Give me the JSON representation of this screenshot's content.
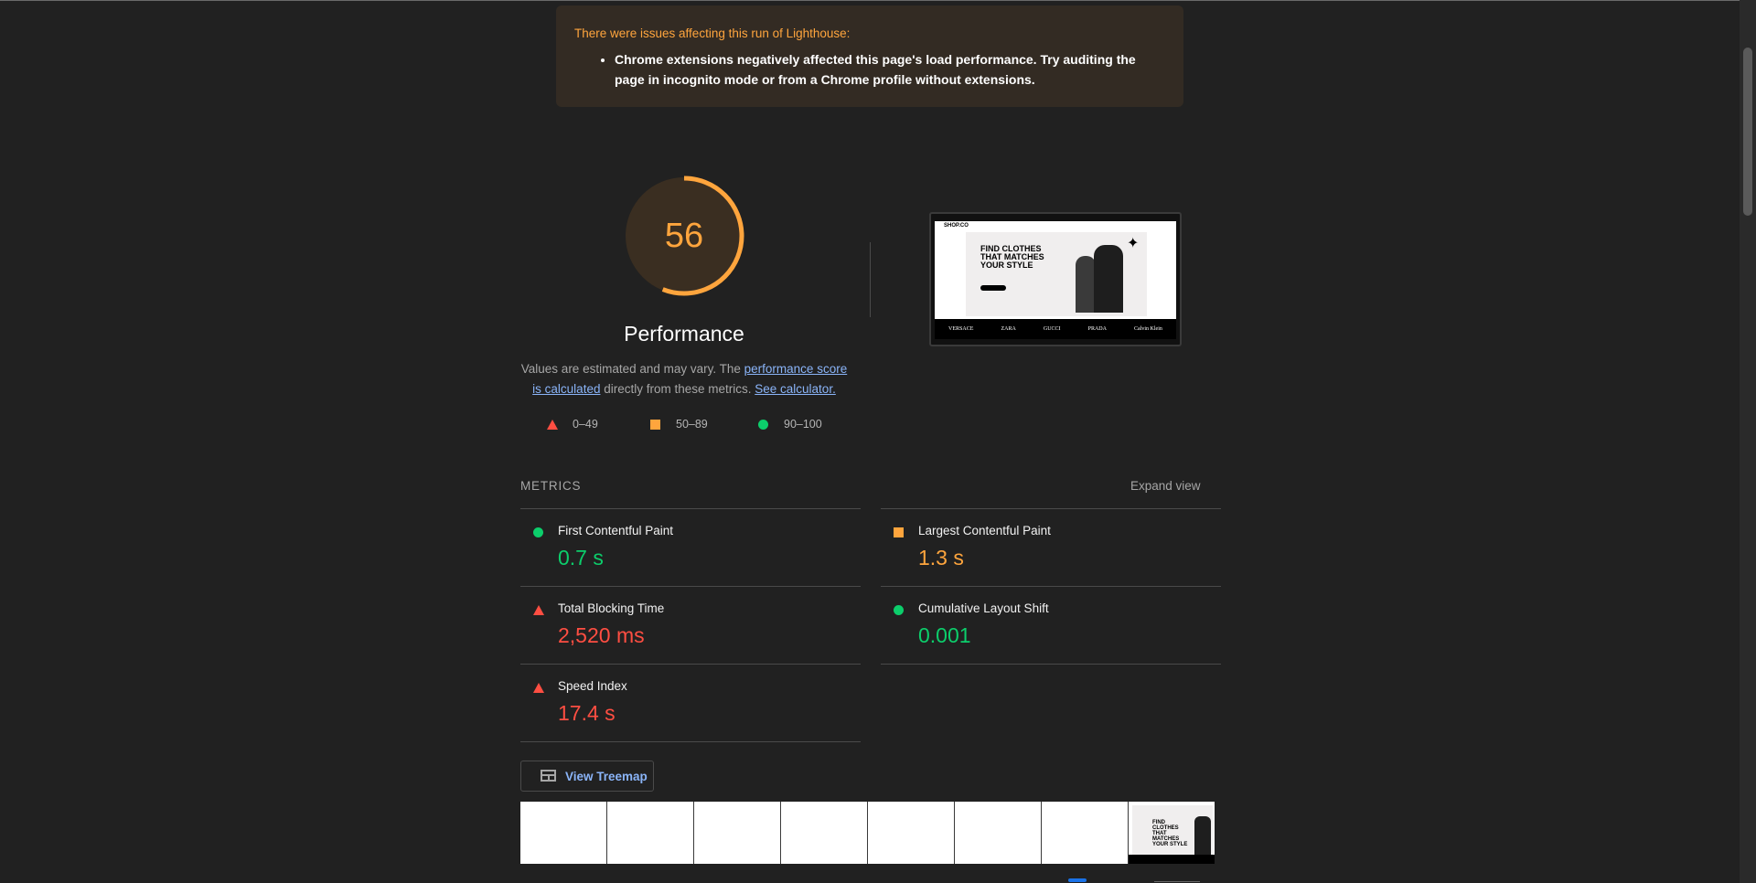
{
  "warning": {
    "title": "There were issues affecting this run of Lighthouse:",
    "items": [
      "Chrome extensions negatively affected this page's load performance. Try auditing the page in incognito mode or from a Chrome profile without extensions."
    ]
  },
  "performance": {
    "score": "56",
    "score_fraction": 0.56,
    "title": "Performance",
    "desc_prefix": "Values are estimated and may vary. The ",
    "desc_link": "performance score is calculated",
    "desc_middle": " directly from these metrics. ",
    "desc_link2": "See calculator.",
    "legend": [
      {
        "range": "0–49",
        "shape": "triangle",
        "color": "#ff4e42"
      },
      {
        "range": "50–89",
        "shape": "square",
        "color": "#ffa53d"
      },
      {
        "range": "90–100",
        "shape": "circle",
        "color": "#0cce6b"
      }
    ]
  },
  "screenshot": {
    "logo": "SHOP.CO",
    "headline": "FIND CLOTHES THAT MATCHES YOUR STYLE",
    "brands": [
      "VERSACE",
      "ZARA",
      "GUCCI",
      "PRADA",
      "Calvin Klein"
    ]
  },
  "metrics": {
    "header": "METRICS",
    "expand": "Expand view",
    "items": [
      {
        "name": "First Contentful Paint",
        "value": "0.7 s",
        "rating": "pass"
      },
      {
        "name": "Largest Contentful Paint",
        "value": "1.3 s",
        "rating": "average"
      },
      {
        "name": "Total Blocking Time",
        "value": "2,520 ms",
        "rating": "fail"
      },
      {
        "name": "Cumulative Layout Shift",
        "value": "0.001",
        "rating": "pass"
      },
      {
        "name": "Speed Index",
        "value": "17.4 s",
        "rating": "fail"
      }
    ]
  },
  "treemap": {
    "label": "View Treemap"
  },
  "filmstrip": {
    "mini_headline": "FIND CLOTHES THAT MATCHES YOUR STYLE"
  },
  "colors": {
    "pass": "#0cce6b",
    "average": "#ffa53d",
    "fail": "#ff4e42",
    "link": "#8ab4f8"
  }
}
